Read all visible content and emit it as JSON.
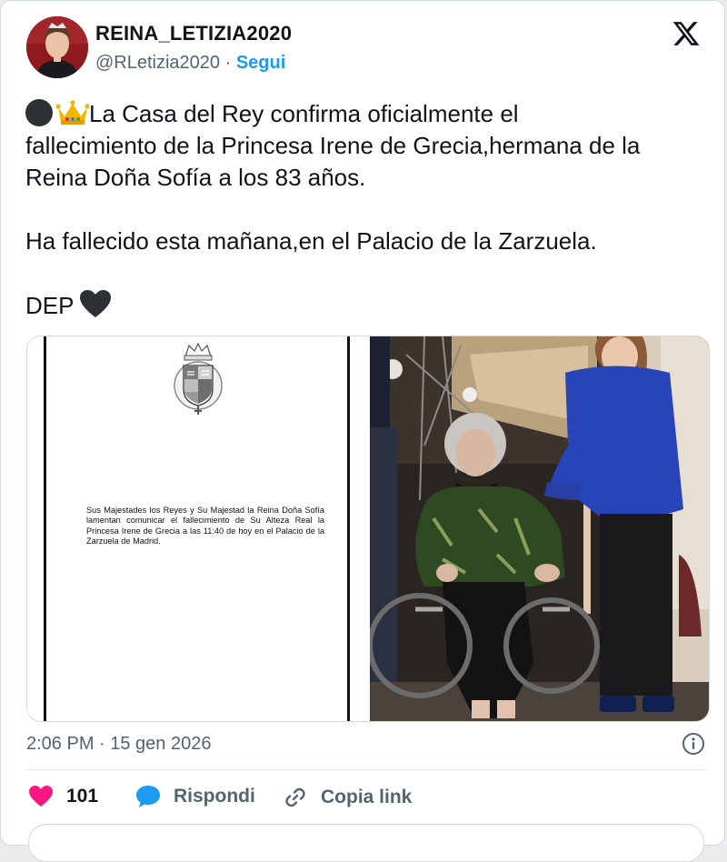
{
  "author": {
    "name": "REINA_LETIZIA2020",
    "handle": "@RLetizia2020",
    "separator": " · ",
    "follow_label": "Segui"
  },
  "post": {
    "line1": "La Casa del Rey confirma oficialmente el",
    "line2": "fallecimiento de la Princesa Irene de Grecia,hermana de la",
    "line3": "Reina Doña Sofía a los 83 años.",
    "paragraph2": "Ha fallecido esta mañana,en el Palacio de la Zarzuela.",
    "paragraph3": "DEP"
  },
  "media": {
    "statement": "Sus Majestades los Reyes y Su Majestad la Reina Doña Sofía lamentan comunicar el fallecimiento de Su Alteza Real la Princesa Irene de Grecia a las 11:40 de hoy en el Palacio de la Zarzuela de Madrid."
  },
  "meta": {
    "timestamp": "2:06 PM · 15 gen 2026"
  },
  "actions": {
    "like_count": "101",
    "reply_label": "Rispondi",
    "copy_label": "Copia link"
  },
  "icons": {
    "logo": "x-logo-icon",
    "info": "info-icon",
    "like": "heart-icon",
    "reply": "speech-bubble-icon",
    "copy": "link-icon"
  },
  "colors": {
    "accent": "#1d9bf0",
    "like": "#f91880",
    "secondary_text": "#536471",
    "jacket": "#2744b8"
  }
}
